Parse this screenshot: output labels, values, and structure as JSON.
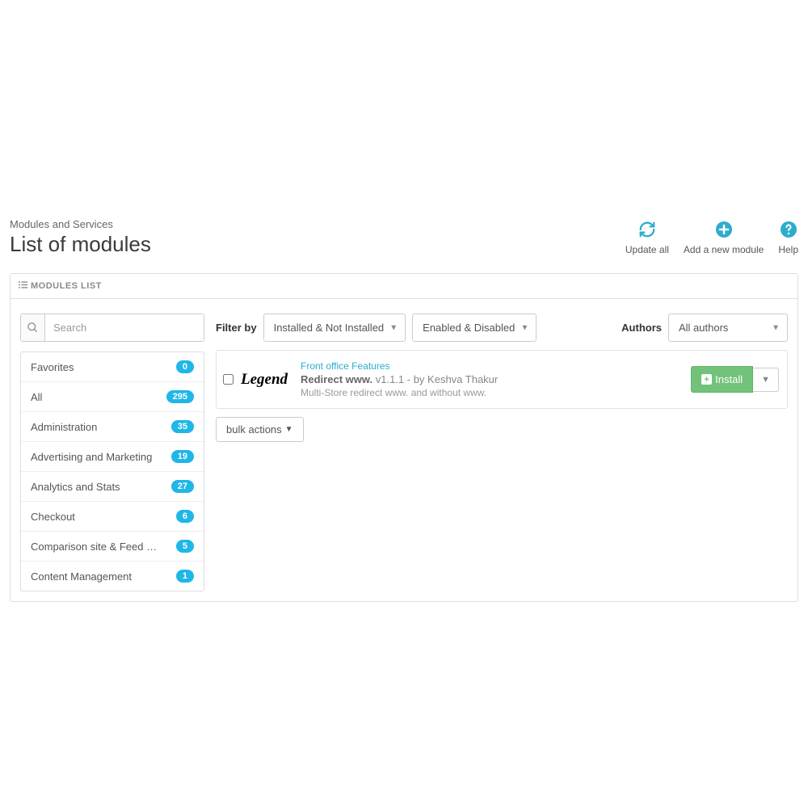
{
  "header": {
    "breadcrumb": "Modules and Services",
    "title": "List of modules",
    "actions": {
      "update_all": "Update all",
      "add_module": "Add a new module",
      "help": "Help"
    }
  },
  "panel": {
    "title": "MODULES LIST"
  },
  "sidebar": {
    "search_placeholder": "Search",
    "categories": [
      {
        "label": "Favorites",
        "count": "0"
      },
      {
        "label": "All",
        "count": "295"
      },
      {
        "label": "Administration",
        "count": "35"
      },
      {
        "label": "Advertising and Marketing",
        "count": "19"
      },
      {
        "label": "Analytics and Stats",
        "count": "27"
      },
      {
        "label": "Checkout",
        "count": "6"
      },
      {
        "label": "Comparison site & Feed manage...",
        "count": "5"
      },
      {
        "label": "Content Management",
        "count": "1"
      }
    ]
  },
  "filters": {
    "filter_label": "Filter by",
    "installed": "Installed & Not Installed",
    "enabled": "Enabled & Disabled",
    "authors_label": "Authors",
    "authors_value": "All authors"
  },
  "module": {
    "logo_text": "Legend",
    "category": "Front office Features",
    "name": "Redirect www.",
    "version": "v1.1.1 - by Keshva Thakur",
    "desc": "Multi-Store redirect www. and without www.",
    "install_label": "Install"
  },
  "bulk": {
    "label": "bulk actions"
  }
}
